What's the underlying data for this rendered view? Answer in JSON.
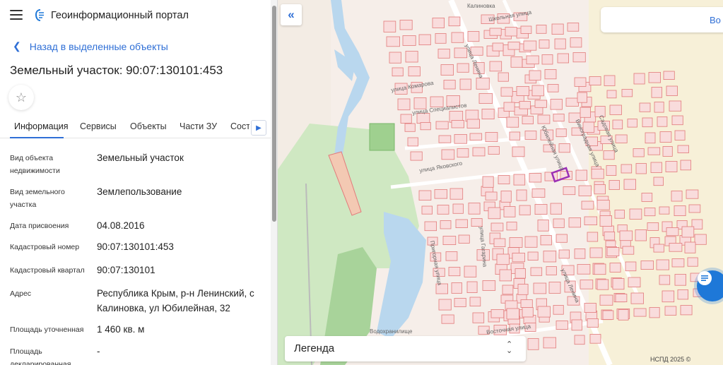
{
  "app": {
    "title": "Геоинформационный портал"
  },
  "nav": {
    "back_label": "Назад в выделенные объекты"
  },
  "object": {
    "title": "Земельный участок: 90:07:130101:453"
  },
  "tabs": [
    {
      "label": "Информация"
    },
    {
      "label": "Сервисы"
    },
    {
      "label": "Объекты"
    },
    {
      "label": "Части ЗУ"
    },
    {
      "label": "Соста"
    }
  ],
  "properties": [
    {
      "label": "Вид объекта недвижимости",
      "value": "Земельный участок"
    },
    {
      "label": "Вид земельного участка",
      "value": "Землепользование"
    },
    {
      "label": "Дата присвоения",
      "value": "04.08.2016"
    },
    {
      "label": "Кадастровый номер",
      "value": "90:07:130101:453"
    },
    {
      "label": "Кадастровый квартал",
      "value": "90:07:130101"
    },
    {
      "label": "Адрес",
      "value": "Республика Крым, р-н Ленинский, с Калиновка, ул Юбилейная, 32"
    },
    {
      "label": "Площадь уточненная",
      "value": "1 460 кв. м"
    },
    {
      "label": "Площадь декларированная",
      "value": "-"
    }
  ],
  "map": {
    "search_placeholder": "Во",
    "legend_label": "Легенда",
    "attribution": "НСПД 2025 ©",
    "labels": {
      "village": "Калиновка",
      "street_shkolnaya": "Школьная улица",
      "street_lenina": "улица Ленина",
      "street_komarova": "улица Комарова",
      "street_specialistov": "улица Специалистов",
      "street_yubileynaya": "Юбилейная улица",
      "street_vinogradnaya": "Виноградная улица",
      "street_sadovaya": "Садовая улица",
      "street_yakovskogo": "улица Яковского",
      "street_gagarina": "улица Гагарина",
      "street_prigornaya": "Пригорная улица",
      "street_lenina2": "улица Ленина",
      "street_vostochnaya": "Восточная улица",
      "reservoir": "Водохранилище"
    },
    "colors": {
      "parcel_stroke": "#e27b7b",
      "parcel_fill": "#f9dcdc",
      "selected": "#9b2fb5",
      "green": "#cfe8c2",
      "water": "#b9d7ee",
      "accent": "#2f6fd6"
    }
  }
}
